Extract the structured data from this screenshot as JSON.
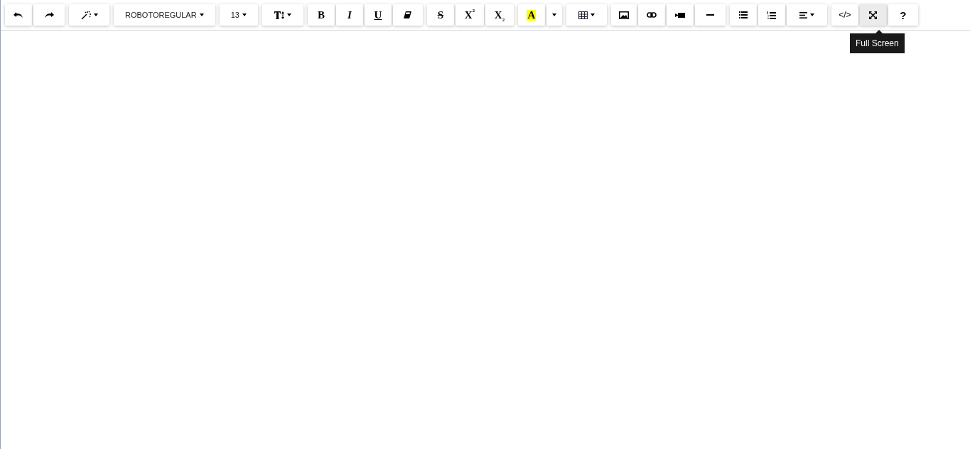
{
  "toolbar": {
    "groups": [
      [
        {
          "kind": "undo",
          "highlighted": false
        },
        {
          "kind": "redo",
          "highlighted": false
        }
      ],
      [
        {
          "kind": "magic",
          "caret": true,
          "highlighted": false
        }
      ],
      [
        {
          "kind": "text",
          "label": "ROBOTOREGULAR",
          "caret": true,
          "highlighted": false
        }
      ],
      [
        {
          "kind": "text",
          "label": "13",
          "caret": true,
          "highlighted": false
        }
      ],
      [
        {
          "kind": "size",
          "caret": true,
          "highlighted": false
        }
      ],
      [
        {
          "kind": "bold",
          "label": "B",
          "highlighted": false
        },
        {
          "kind": "italic",
          "label": "I",
          "highlighted": false
        },
        {
          "kind": "underline",
          "label": "U",
          "highlighted": false
        },
        {
          "kind": "eraser",
          "highlighted": false
        }
      ],
      [
        {
          "kind": "strike",
          "label": "S",
          "highlighted": false
        },
        {
          "kind": "script",
          "label": "X$^{²}$",
          "highlighted": false
        },
        {
          "kind": "script",
          "label": "X$_{₂}$",
          "highlighted": false
        }
      ],
      [
        {
          "kind": "color",
          "label": "A",
          "highlighted": false
        },
        {
          "kind": "dropdown",
          "caret": true,
          "highlighted": false
        }
      ],
      [
        {
          "kind": "table",
          "caret": true,
          "highlighted": false
        }
      ],
      [
        {
          "kind": "image",
          "highlighted": false
        },
        {
          "kind": "link",
          "highlighted": false
        },
        {
          "kind": "video",
          "highlighted": false
        },
        {
          "kind": "rule",
          "highlighted": false
        }
      ],
      [
        {
          "kind": "bullets",
          "highlighted": false
        },
        {
          "kind": "numbers",
          "highlighted": false
        },
        {
          "kind": "align",
          "caret": true,
          "highlighted": false
        }
      ],
      [
        {
          "kind": "code",
          "label": "</>",
          "highlighted": false
        },
        {
          "kind": "fullscreen",
          "highlighted": true
        },
        {
          "kind": "help",
          "label": "?",
          "highlighted": false
        }
      ]
    ]
  },
  "tooltip": {
    "text": "Full Screen"
  }
}
